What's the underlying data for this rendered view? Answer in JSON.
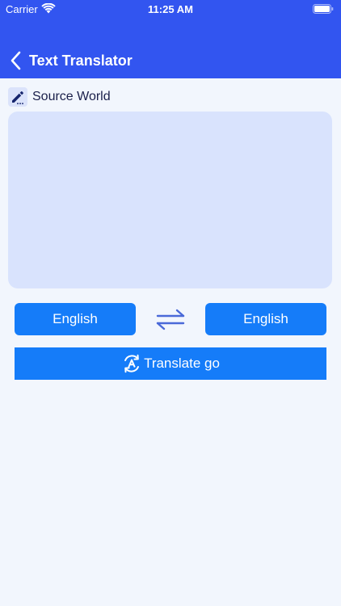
{
  "status_bar": {
    "carrier": "Carrier",
    "time": "11:25 AM",
    "icons": [
      "wifi-icon",
      "battery-icon"
    ]
  },
  "nav": {
    "title": "Text Translator",
    "back_icon": "chevron-left-icon"
  },
  "source": {
    "label": "Source World",
    "icon": "pencil-icon",
    "input_value": "",
    "placeholder": ""
  },
  "languages": {
    "source": "English",
    "target": "English",
    "swap_icon": "swap-arrows-icon"
  },
  "translate": {
    "label": "Translate go",
    "icon": "translate-icon"
  },
  "colors": {
    "header": "#3255f0",
    "background": "#f2f6fd",
    "textarea": "#d9e3fd",
    "button": "#157cf9",
    "swap_icon": "#4a69d8",
    "label_text": "#1a1f4a"
  }
}
